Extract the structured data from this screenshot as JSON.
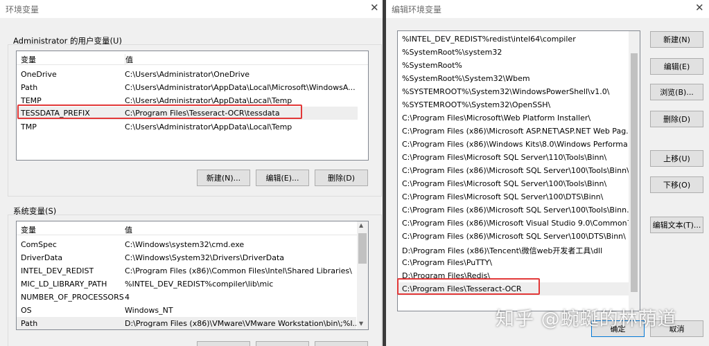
{
  "env_window": {
    "title": "环境变量",
    "user_vars": {
      "label": "Administrator 的用户变量(U)",
      "headers": [
        "变量",
        "值"
      ],
      "rows": [
        {
          "name": "OneDrive",
          "value": "C:\\Users\\Administrator\\OneDrive"
        },
        {
          "name": "Path",
          "value": "C:\\Users\\Administrator\\AppData\\Local\\Microsoft\\WindowsA..."
        },
        {
          "name": "TEMP",
          "value": "C:\\Users\\Administrator\\AppData\\Local\\Temp"
        },
        {
          "name": "TESSDATA_PREFIX",
          "value": "C:\\Program Files\\Tesseract-OCR\\tessdata"
        },
        {
          "name": "TMP",
          "value": "C:\\Users\\Administrator\\AppData\\Local\\Temp"
        }
      ],
      "buttons": {
        "new": "新建(N)...",
        "edit": "编辑(E)...",
        "delete": "删除(D)"
      }
    },
    "system_vars": {
      "label": "系统变量(S)",
      "headers": [
        "变量",
        "值"
      ],
      "rows": [
        {
          "name": "ComSpec",
          "value": "C:\\Windows\\system32\\cmd.exe"
        },
        {
          "name": "DriverData",
          "value": "C:\\Windows\\System32\\Drivers\\DriverData"
        },
        {
          "name": "INTEL_DEV_REDIST",
          "value": "C:\\Program Files (x86)\\Common Files\\Intel\\Shared Libraries\\"
        },
        {
          "name": "MIC_LD_LIBRARY_PATH",
          "value": "%INTEL_DEV_REDIST%compiler\\lib\\mic"
        },
        {
          "name": "NUMBER_OF_PROCESSORS",
          "value": "4"
        },
        {
          "name": "OS",
          "value": "Windows_NT"
        },
        {
          "name": "Path",
          "value": "D:\\Program Files (x86)\\VMware\\VMware Workstation\\bin\\;%I..."
        }
      ]
    }
  },
  "edit_window": {
    "title": "编辑环境变量",
    "paths": [
      "%INTEL_DEV_REDIST%redist\\intel64\\compiler",
      "%SystemRoot%\\system32",
      "%SystemRoot%",
      "%SystemRoot%\\System32\\Wbem",
      "%SYSTEMROOT%\\System32\\WindowsPowerShell\\v1.0\\",
      "%SYSTEMROOT%\\System32\\OpenSSH\\",
      "C:\\Program Files\\Microsoft\\Web Platform Installer\\",
      "C:\\Program Files (x86)\\Microsoft ASP.NET\\ASP.NET Web Pag...",
      "C:\\Program Files (x86)\\Windows Kits\\8.0\\Windows Performa...",
      "C:\\Program Files\\Microsoft SQL Server\\110\\Tools\\Binn\\",
      "C:\\Program Files (x86)\\Microsoft SQL Server\\100\\Tools\\Binn\\",
      "C:\\Program Files\\Microsoft SQL Server\\100\\Tools\\Binn\\",
      "C:\\Program Files\\Microsoft SQL Server\\100\\DTS\\Binn\\",
      "C:\\Program Files (x86)\\Microsoft SQL Server\\100\\Tools\\Binn...",
      "C:\\Program Files (x86)\\Microsoft Visual Studio 9.0\\Common7...",
      "C:\\Program Files (x86)\\Microsoft SQL Server\\100\\DTS\\Binn\\",
      "D:\\Program Files (x86)\\Tencent\\微信web开发者工具\\dll",
      "C:\\Program Files\\PuTTY\\",
      "D:\\Program Files\\Redis\\",
      "C:\\Program Files\\Tesseract-OCR"
    ],
    "buttons": {
      "new": "新建(N)",
      "edit": "编辑(E)",
      "browse": "浏览(B)...",
      "delete": "删除(D)",
      "move_up": "上移(U)",
      "move_down": "下移(O)",
      "edit_text": "编辑文本(T)...",
      "ok": "确定",
      "cancel": "取消"
    }
  },
  "watermark": "知乎 @蜿蜒的林荫道",
  "colors": {
    "highlight": "#e23737",
    "selection": "#eeeeee",
    "accent": "#0078d7"
  }
}
